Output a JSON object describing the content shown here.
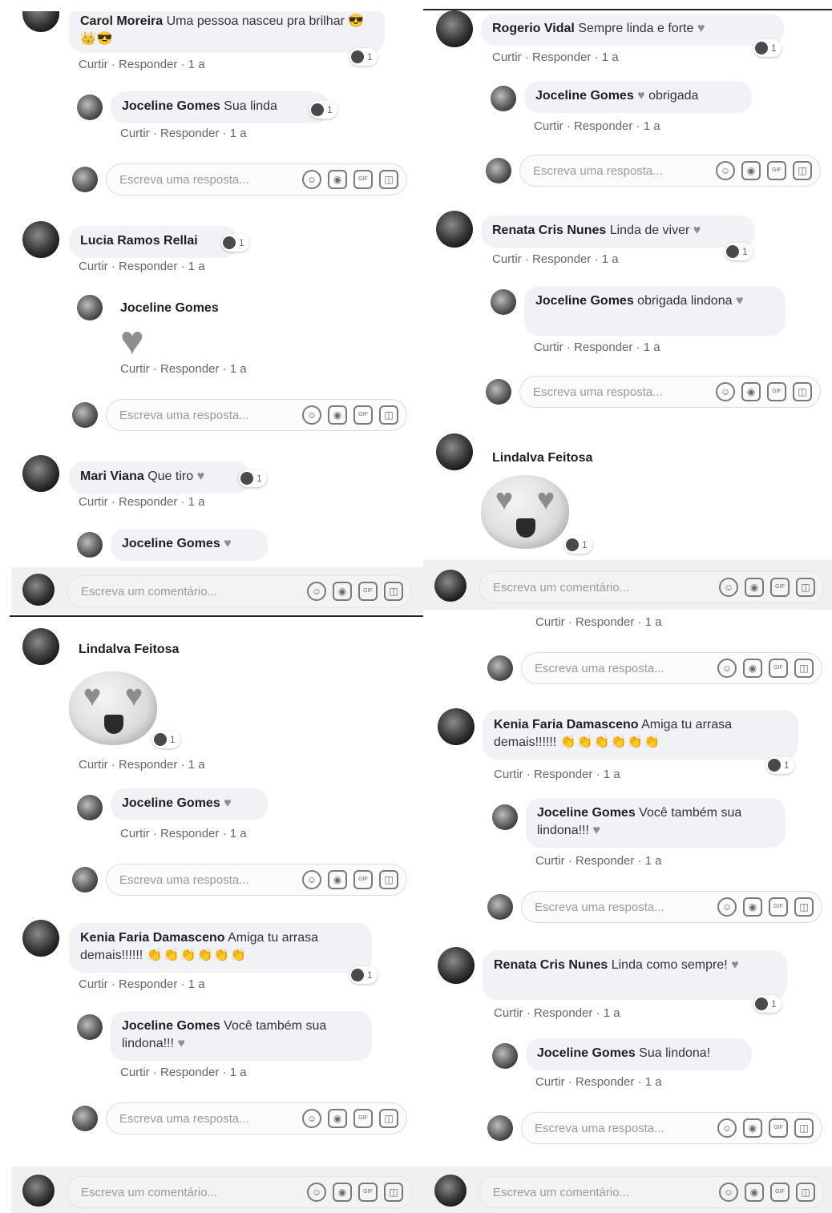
{
  "placeholders": {
    "reply": "Escreva uma resposta...",
    "comment": "Escreva um comentário..."
  },
  "actions": {
    "like": "Curtir",
    "reply": "Responder",
    "sep": "·",
    "time": "1 a"
  },
  "reaction_count": "1",
  "heart": "♥",
  "eye_heart": "♥",
  "tool_icons": {
    "emoji": "☺",
    "camera": "◉",
    "gif": "GIF",
    "sticker": "◫"
  },
  "panel_a": {
    "c1": {
      "name": "Carol Moreira",
      "text": "Uma pessoa nasceu pra brilhar",
      "emojis": "😎👑😎"
    },
    "r1": {
      "name": "Joceline Gomes",
      "text": "Sua linda"
    },
    "c2": {
      "name": "Lucia Ramos Rellai",
      "text": ""
    },
    "r2": {
      "name": "Joceline Gomes"
    },
    "c3": {
      "name": "Mari Viana",
      "text": "Que tiro"
    },
    "r3": {
      "name": "Joceline Gomes"
    }
  },
  "panel_b": {
    "c1": {
      "name": "Rogerio Vidal",
      "text": "Sempre linda e forte"
    },
    "r1": {
      "name": "Joceline Gomes",
      "text": "obrigada"
    },
    "c2": {
      "name": "Renata Cris Nunes",
      "text": "Linda de viver"
    },
    "r2": {
      "name": "Joceline Gomes",
      "text": "obrigada lindona"
    },
    "c3": {
      "name": "Lindalva Feitosa"
    }
  },
  "panel_c": {
    "c1": {
      "name": "Lindalva Feitosa"
    },
    "r1": {
      "name": "Joceline Gomes"
    },
    "c2": {
      "name": "Kenia Faria Damasceno",
      "text": "Amiga tu arrasa demais!!!!!!",
      "emojis": "👏👏👏👏👏👏"
    },
    "r2": {
      "name": "Joceline Gomes",
      "text": "Você também sua lindona!!!"
    }
  },
  "panel_d": {
    "c1": {
      "name": "Kenia Faria Damasceno",
      "text": "Amiga tu arrasa demais!!!!!!",
      "emojis": "👏👏👏👏👏👏"
    },
    "r1": {
      "name": "Joceline Gomes",
      "text": "Você também sua lindona!!!"
    },
    "c2": {
      "name": "Renata Cris Nunes",
      "text": "Linda como sempre!"
    },
    "r2": {
      "name": "Joceline Gomes",
      "text": "Sua lindona!"
    }
  }
}
